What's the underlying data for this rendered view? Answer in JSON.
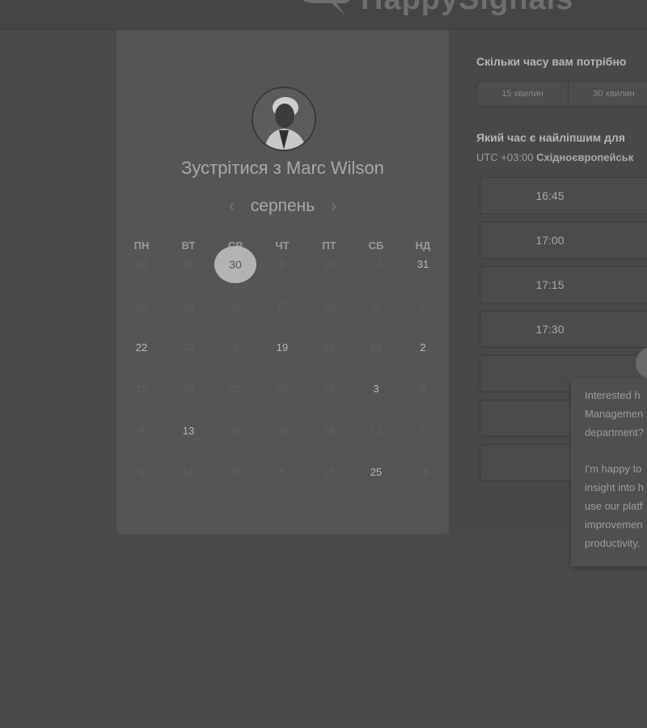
{
  "header": {
    "brand": "HappySignals"
  },
  "meeting": {
    "title": "Зустрітися з Marc Wilson",
    "month": "серпень"
  },
  "calendar": {
    "weekdays": [
      "ПН",
      "ВТ",
      "СР",
      "ЧТ",
      "ПТ",
      "СБ",
      "НД"
    ],
    "selected_day": "30",
    "rows": [
      [
        {
          "d": "24",
          "a": false
        },
        {
          "d": "30",
          "a": false
        },
        {
          "d": "30",
          "a": true,
          "sel": true
        },
        {
          "d": "6",
          "a": false
        },
        {
          "d": "10",
          "a": false
        },
        {
          "d": "14",
          "a": false
        },
        {
          "d": "31",
          "a": true
        }
      ],
      [
        {
          "d": "10",
          "a": false
        },
        {
          "d": "14",
          "a": false
        },
        {
          "d": "31",
          "a": false
        },
        {
          "d": "17",
          "a": false
        },
        {
          "d": "25",
          "a": false
        },
        {
          "d": "9",
          "a": false
        },
        {
          "d": "5",
          "a": false
        }
      ],
      [
        {
          "d": "22",
          "a": true
        },
        {
          "d": "22",
          "a": false
        },
        {
          "d": "5",
          "a": false
        },
        {
          "d": "19",
          "a": true
        },
        {
          "d": "15",
          "a": false
        },
        {
          "d": "29",
          "a": false
        },
        {
          "d": "2",
          "a": true
        }
      ],
      [
        {
          "d": "10",
          "a": false
        },
        {
          "d": "29",
          "a": false
        },
        {
          "d": "22",
          "a": false
        },
        {
          "d": "28",
          "a": false
        },
        {
          "d": "14",
          "a": false
        },
        {
          "d": "3",
          "a": true
        },
        {
          "d": "8",
          "a": false
        }
      ],
      [
        {
          "d": "9",
          "a": false
        },
        {
          "d": "13",
          "a": true
        },
        {
          "d": "20",
          "a": false
        },
        {
          "d": "20",
          "a": false
        },
        {
          "d": "16",
          "a": false
        },
        {
          "d": "13",
          "a": false
        },
        {
          "d": "2",
          "a": false
        }
      ],
      [
        {
          "d": "9",
          "a": false
        },
        {
          "d": "14",
          "a": false
        },
        {
          "d": "25",
          "a": false
        },
        {
          "d": "5",
          "a": false
        },
        {
          "d": "15",
          "a": false
        },
        {
          "d": "25",
          "a": true
        },
        {
          "d": "18",
          "a": false
        }
      ]
    ]
  },
  "booking": {
    "duration_question": "Скільки часу вам потрібно",
    "durations": [
      "15 хвилин",
      "30 хвилин"
    ],
    "time_question": "Який час є найліпшим для",
    "tz_offset": "UTC +03:00",
    "tz_name": "Східноєвропейськ",
    "slots": [
      "16:45",
      "17:00",
      "17:15",
      "17:30",
      "",
      "",
      ""
    ]
  },
  "chat": {
    "lines1": [
      "Interested h",
      "Managemen",
      "department?"
    ],
    "lines2": [
      "I'm happy to",
      "insight into h",
      "use our platf",
      "improvemen",
      "productivity."
    ]
  }
}
